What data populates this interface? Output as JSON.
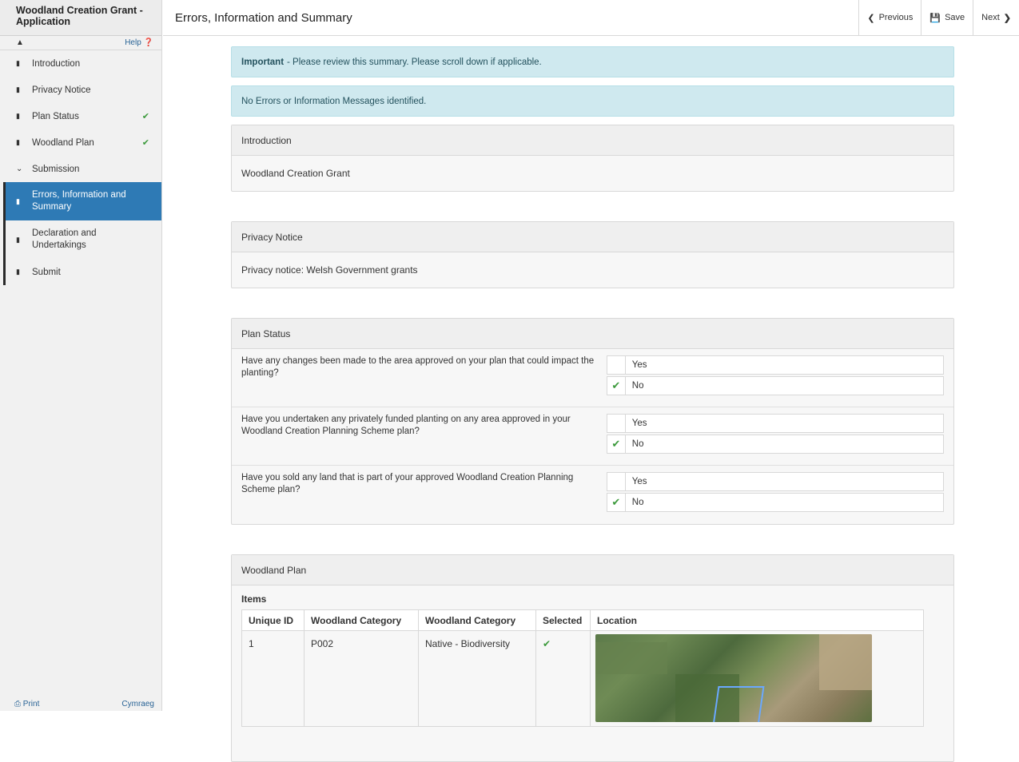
{
  "app": {
    "title": "Woodland Creation Grant - Application"
  },
  "sidebar": {
    "help_label": "Help",
    "items": [
      {
        "label": "Introduction",
        "done": false
      },
      {
        "label": "Privacy Notice",
        "done": false
      },
      {
        "label": "Plan Status",
        "done": true
      },
      {
        "label": "Woodland Plan",
        "done": true
      }
    ],
    "submission": {
      "label": "Submission",
      "items": [
        {
          "label": "Errors, Information and Summary",
          "active": true
        },
        {
          "label": "Declaration and Undertakings",
          "active": false
        },
        {
          "label": "Submit",
          "active": false
        }
      ]
    },
    "footer": {
      "print_label": "Print",
      "language_label": "Cymraeg"
    }
  },
  "topbar": {
    "title": "Errors, Information and Summary",
    "previous_label": "Previous",
    "save_label": "Save",
    "next_label": "Next"
  },
  "alerts": {
    "important_bold": "Important",
    "important_text": "- Please review this summary. Please scroll down if applicable.",
    "no_errors": "No Errors or Information Messages identified."
  },
  "introduction": {
    "heading": "Introduction",
    "body": "Woodland Creation Grant"
  },
  "privacy": {
    "heading": "Privacy Notice",
    "body": "Privacy notice: Welsh Government grants"
  },
  "plan_status": {
    "heading": "Plan Status",
    "questions": [
      {
        "text": "Have any changes been made to the area approved on your plan that could impact the planting?",
        "options": [
          {
            "label": "Yes",
            "selected": false
          },
          {
            "label": "No",
            "selected": true
          }
        ]
      },
      {
        "text": "Have you undertaken any privately funded planting on any area approved in your Woodland Creation Planning Scheme plan?",
        "options": [
          {
            "label": "Yes",
            "selected": false
          },
          {
            "label": "No",
            "selected": true
          }
        ]
      },
      {
        "text": "Have you sold any land that is part of your approved Woodland Creation Planning Scheme plan?",
        "options": [
          {
            "label": "Yes",
            "selected": false
          },
          {
            "label": "No",
            "selected": true
          }
        ]
      }
    ]
  },
  "woodland_plan": {
    "heading": "Woodland Plan",
    "items_label": "Items",
    "columns": [
      "Unique ID",
      "Woodland Category",
      "Woodland Category",
      "Selected",
      "Location"
    ],
    "rows": [
      {
        "id": "1",
        "category_code": "P002",
        "category_name": "Native - Biodiversity",
        "selected": true
      }
    ]
  }
}
